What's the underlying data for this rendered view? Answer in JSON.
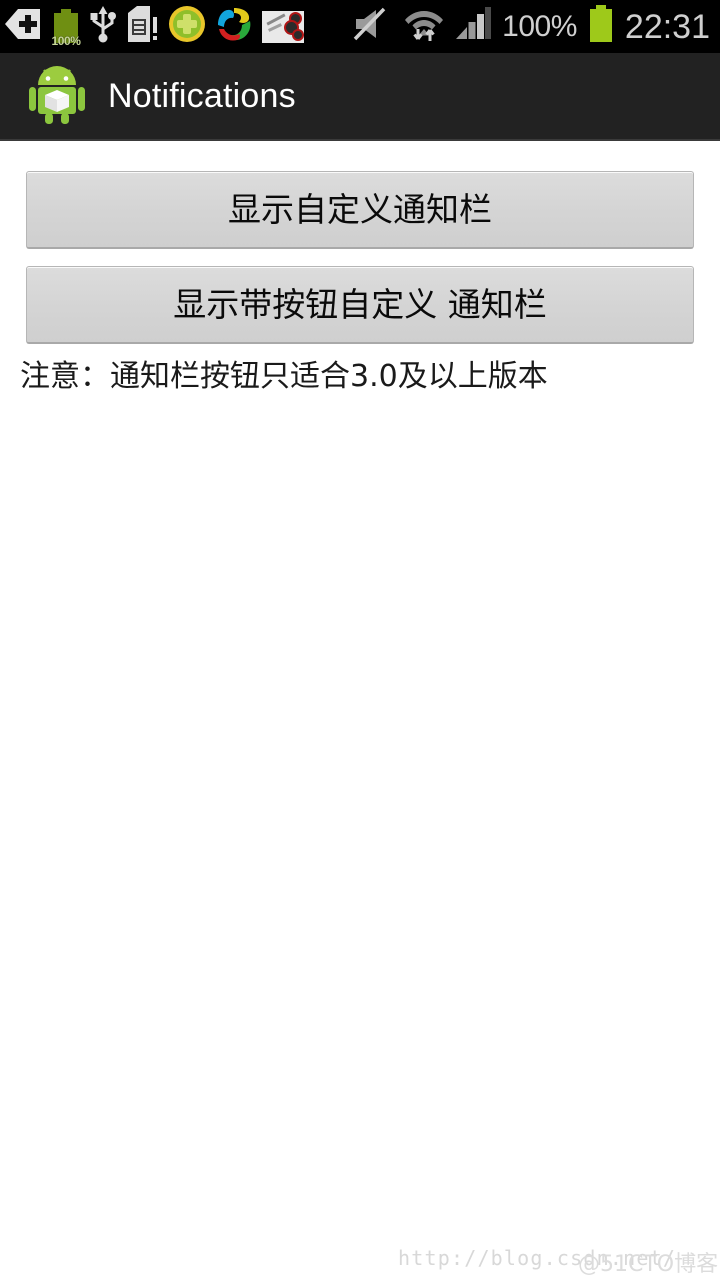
{
  "status_bar": {
    "background": "#000000",
    "left_icons": [
      {
        "name": "add-shortcut-icon",
        "label": ""
      },
      {
        "name": "battery-charge-icon",
        "label": "100%"
      },
      {
        "name": "usb-icon",
        "label": ""
      },
      {
        "name": "sim-card-alert-icon",
        "label": ""
      },
      {
        "name": "security-plus-icon",
        "label": ""
      },
      {
        "name": "swirl-app-icon",
        "label": ""
      },
      {
        "name": "photo-thumbnail-icon",
        "label": ""
      }
    ],
    "right_icons": [
      {
        "name": "mute-icon",
        "label": ""
      },
      {
        "name": "wifi-data-icon",
        "label": ""
      },
      {
        "name": "signal-bars-icon",
        "label": ""
      }
    ],
    "battery_percent": "100%",
    "battery_color": "#9ec91a",
    "clock": "22:31",
    "text_color": "#cfcfcf"
  },
  "action_bar": {
    "background": "#222222",
    "icon": "android-robot-box-icon",
    "title": "Notifications",
    "title_color": "#ffffff"
  },
  "content": {
    "background": "#ffffff",
    "buttons": [
      {
        "name": "show-custom-notification-button",
        "label": "显示自定义通知栏"
      },
      {
        "name": "show-custom-notification-with-button-button",
        "label": "显示带按钮自定义 通知栏"
      }
    ],
    "note": "注意：通知栏按钮只适合3.0及以上版本",
    "button_fill": "#d6d6d6",
    "button_text_color": "#0a0a0a"
  },
  "watermarks": {
    "url": "http://blog.csdn.net/",
    "site": "@51CTO博客",
    "color": "#d8d8d8"
  }
}
